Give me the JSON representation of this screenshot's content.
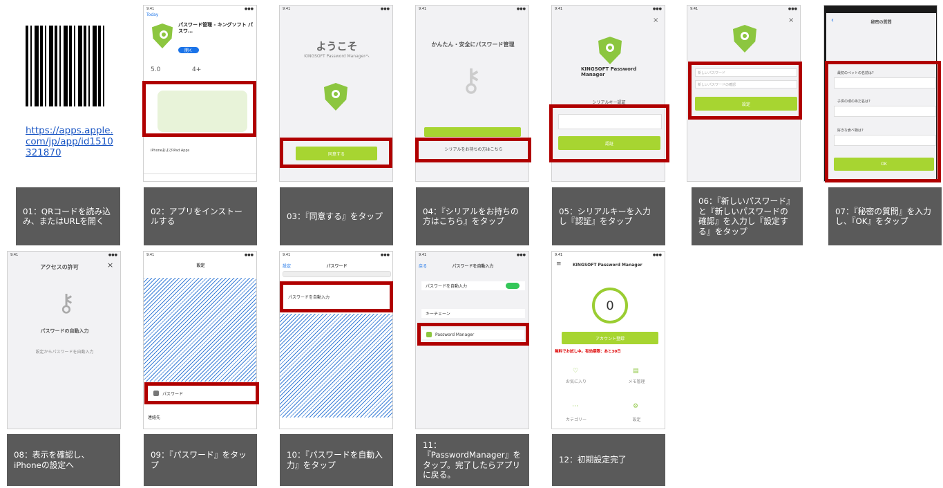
{
  "qr_link": "https://apps.apple.com/jp/app/id1510321870",
  "captions": [
    "01：QRコードを読み込み、またはURLを開く",
    "02：アプリをインストールする",
    "03：『同意する』をタップ",
    "04：『シリアルをお持ちの方はこちら』をタップ",
    "05：シリアルキーを入力し『認証』をタップ",
    "06：『新しいパスワード』と『新しいパスワードの確認』を入力し『設定する』をタップ",
    "07：『秘密の質問』を入力し、『OK』をタップ",
    "08：表示を確認し、iPhoneの設定へ",
    "09：『パスワード』をタップ",
    "10：『パスワードを自動入力』をタップ",
    "11：『PasswordManager』をタップ。完了したらアプリに戻る。",
    "12：初期設定完了"
  ],
  "s02": {
    "back": "Today",
    "app_name": "パスワード管理 - キングソフト パスワ…",
    "open": "開く",
    "rating": "5.0",
    "age": "4+",
    "option": "iPhoneおよびiPad Apps"
  },
  "s03": {
    "title": "ようこそ",
    "subtitle": "KINGSOFT Password Managerへ",
    "agree": "同意する"
  },
  "s04": {
    "title": "かんたん・安全にパスワード管理",
    "serial": "シリアルをお持ちの方はこちら"
  },
  "s05": {
    "brand": "KINGSOFT Password Manager",
    "label": "シリアルキー認証",
    "auth": "認証"
  },
  "s06": {
    "f1": "新しいパスワード",
    "f2": "新しいパスワードの確認",
    "btn": "設定"
  },
  "s07": {
    "title": "秘密の質問",
    "q1": "最初のペットの名前は?",
    "q2": "子供の頃のあだ名は?",
    "q3": "好きな食べ物は?",
    "ok": "OK"
  },
  "s08": {
    "title": "アクセスの許可",
    "sub": "パスワードの自動入力",
    "note": "設定からパスワードを自動入力"
  },
  "s09": {
    "title": "設定",
    "item": "パスワード",
    "item2": "連絡先"
  },
  "s10": {
    "back": "設定",
    "title": "パスワード",
    "row": "パスワードを自動入力"
  },
  "s11": {
    "back": "戻る",
    "title": "パスワードを自動入力",
    "toggle": "パスワードを自動入力",
    "keychain": "キーチェーン",
    "pm": "Password Manager"
  },
  "s12": {
    "title": "KINGSOFT Password Manager",
    "count": "0",
    "register": "アカウント登録",
    "warning": "無料でお試し中。有効期限：あと30日",
    "fav": "お気に入り",
    "memo": "メモ管理",
    "category": "カテゴリー",
    "settings": "設定"
  }
}
